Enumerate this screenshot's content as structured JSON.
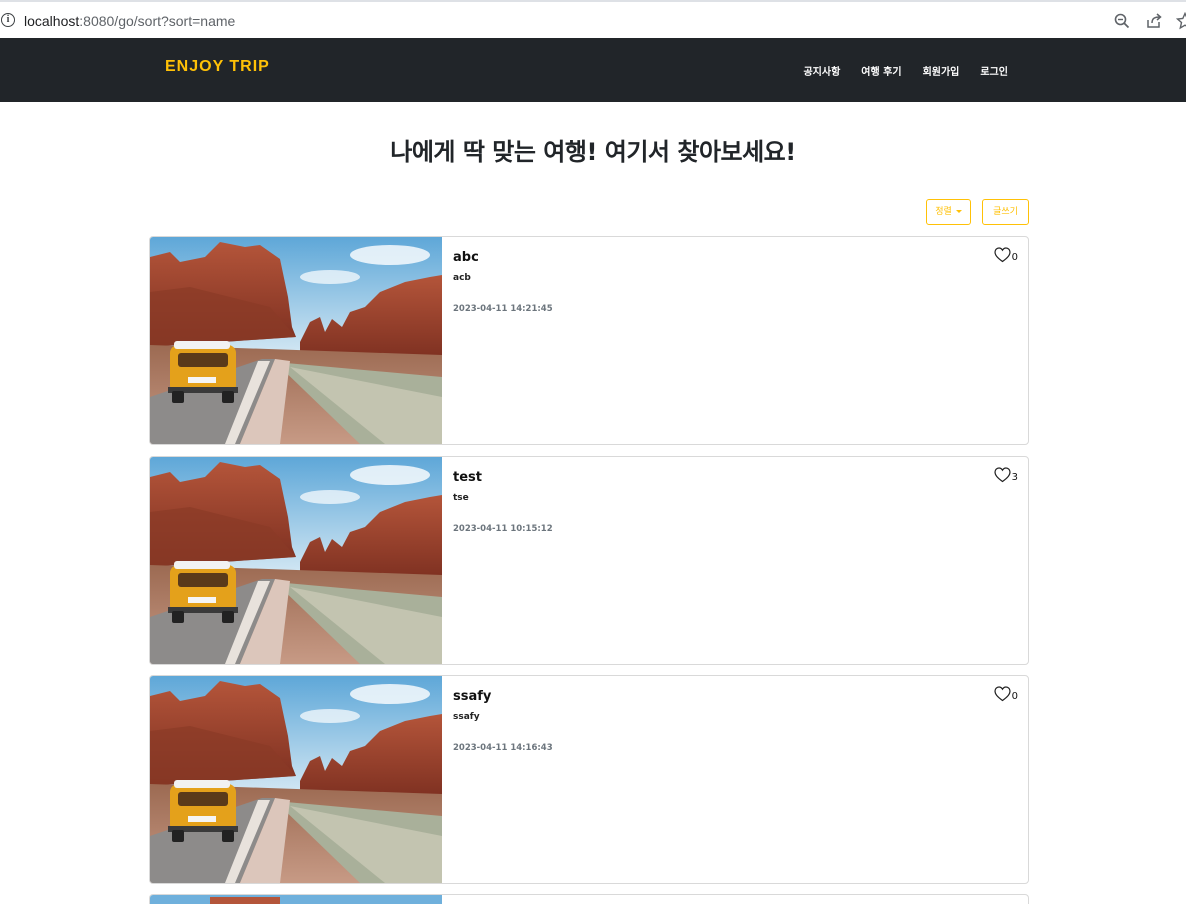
{
  "browser": {
    "url_host": "localhost",
    "url_rest": ":8080/go/sort?sort=name"
  },
  "navbar": {
    "brand": "ENJOY TRIP",
    "links": [
      "공지사항",
      "여행 후기",
      "회원가입",
      "로그인"
    ]
  },
  "headline": "나에게 딱 맞는 여행! 여기서 찾아보세요!",
  "toolbar": {
    "sort_label": "정렬",
    "write_label": "글쓰기"
  },
  "colors": {
    "accent": "#ffc107",
    "navbar_bg": "#212529"
  },
  "posts": [
    {
      "title": "abc",
      "content": "acb",
      "date": "2023-04-11 14:21:45",
      "likes": "0"
    },
    {
      "title": "test",
      "content": "tse",
      "date": "2023-04-11 10:15:12",
      "likes": "3"
    },
    {
      "title": "ssafy",
      "content": "ssafy",
      "date": "2023-04-11 14:16:43",
      "likes": "0"
    }
  ]
}
